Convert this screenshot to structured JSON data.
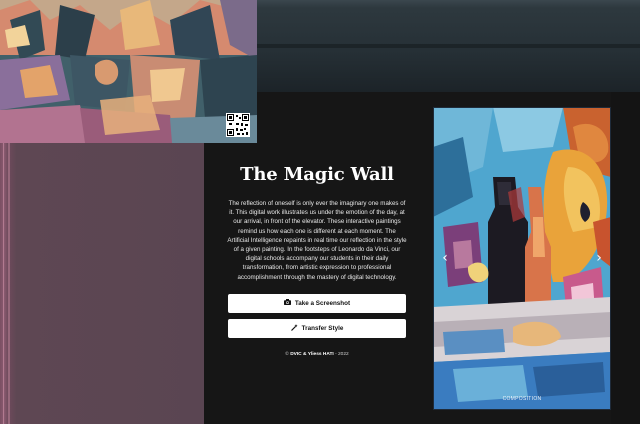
{
  "app": {
    "title": "The Magic Wall",
    "description": "The reflection of oneself is only ever the imaginary one makes of it. This digital work illustrates us under the emotion of the day, at our arrival, in front of the elevator. These interactive paintings remind us how each one is different at each moment. The Artificial Intelligence repaints in real time our reflection in the style of a given painting. In the footsteps of Leonardo da Vinci, our digital schools accompany our students in their daily transformation, from artistic expression to professional accomplishment through the mastery of digital technology."
  },
  "buttons": {
    "screenshot_label": "Take a Screenshot",
    "transfer_label": "Transfer Style",
    "screenshot_icon": "camera-icon",
    "transfer_icon": "magic-wand-icon"
  },
  "footer": {
    "copyright_symbol": "©",
    "owners": "DVIC & Yliess HATI",
    "year": "- 2022"
  },
  "carousel": {
    "caption": "COMPOSITION",
    "prev_icon": "chevron-left-icon",
    "next_icon": "chevron-right-icon"
  },
  "colors": {
    "background": "#161616",
    "panel": "#5a4552",
    "button_bg": "#ffffff",
    "text": "#ffffff"
  }
}
